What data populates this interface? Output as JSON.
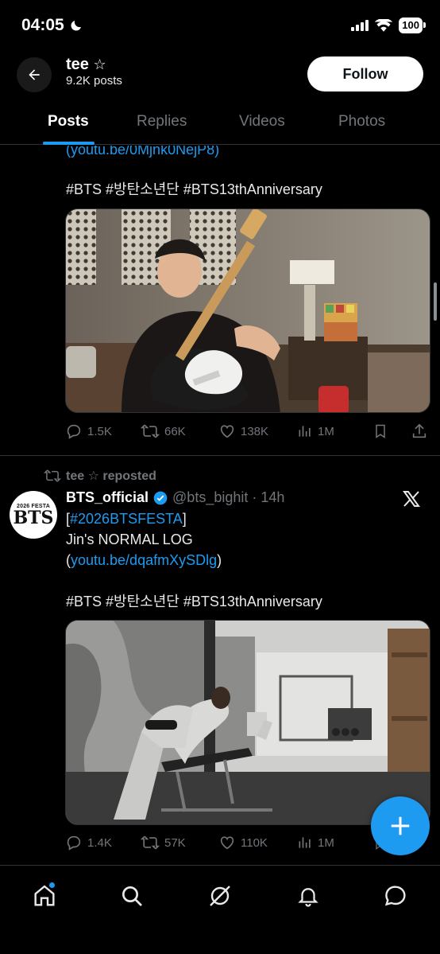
{
  "status_bar": {
    "time": "04:05",
    "battery": "100"
  },
  "header": {
    "name": "tee",
    "star": "☆",
    "posts_count": "9.2K posts",
    "follow_label": "Follow"
  },
  "tabs": [
    {
      "label": "Posts"
    },
    {
      "label": "Replies"
    },
    {
      "label": "Videos"
    },
    {
      "label": "Photos"
    }
  ],
  "post1": {
    "link_cut": "(youtu.be/0Mjnk0NejP8)",
    "hashtags": "#BTS #방탄소년단 #BTS13thAnniversary",
    "stats": {
      "replies": "1.5K",
      "reposts": "66K",
      "likes": "138K",
      "views": "1M"
    }
  },
  "post2": {
    "repost_label": "tee ☆ reposted",
    "avatar_top": "2026 FESTA",
    "avatar_main": "BTS",
    "author_name": "BTS_official",
    "author_handle": "@bts_bighit",
    "time": "· 14h",
    "line1_open": "[",
    "line1_tag": "#2026BTSFESTA",
    "line1_close": "]",
    "line2": "Jin's NORMAL LOG",
    "line3_open": "(",
    "line3_link": "youtu.be/dqafmXySDlg",
    "line3_close": ")",
    "hashtags": "#BTS #방탄소년단 #BTS13thAnniversary",
    "stats": {
      "replies": "1.4K",
      "reposts": "57K",
      "likes": "110K",
      "views": "1M"
    }
  },
  "colors": {
    "accent": "#1d9bf0",
    "background": "#000000",
    "muted": "#71767b"
  },
  "icons": [
    "back-arrow-icon",
    "moon-icon",
    "signal-icon",
    "wifi-icon",
    "battery-icon",
    "reply-icon",
    "repost-icon",
    "like-icon",
    "views-icon",
    "bookmark-icon",
    "share-icon",
    "verified-icon",
    "x-logo-icon",
    "plus-icon",
    "home-icon",
    "search-icon",
    "grok-icon",
    "bell-icon",
    "messages-icon"
  ]
}
